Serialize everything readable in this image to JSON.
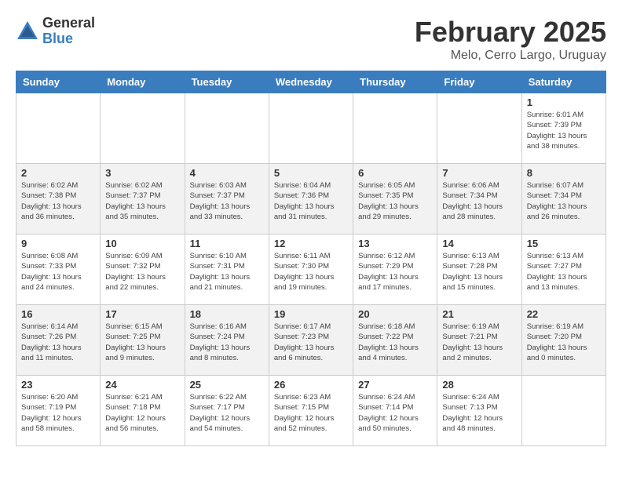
{
  "logo": {
    "general": "General",
    "blue": "Blue"
  },
  "title": "February 2025",
  "subtitle": "Melo, Cerro Largo, Uruguay",
  "days_of_week": [
    "Sunday",
    "Monday",
    "Tuesday",
    "Wednesday",
    "Thursday",
    "Friday",
    "Saturday"
  ],
  "weeks": [
    [
      {
        "day": "",
        "info": ""
      },
      {
        "day": "",
        "info": ""
      },
      {
        "day": "",
        "info": ""
      },
      {
        "day": "",
        "info": ""
      },
      {
        "day": "",
        "info": ""
      },
      {
        "day": "",
        "info": ""
      },
      {
        "day": "1",
        "info": "Sunrise: 6:01 AM\nSunset: 7:39 PM\nDaylight: 13 hours\nand 38 minutes."
      }
    ],
    [
      {
        "day": "2",
        "info": "Sunrise: 6:02 AM\nSunset: 7:38 PM\nDaylight: 13 hours\nand 36 minutes."
      },
      {
        "day": "3",
        "info": "Sunrise: 6:02 AM\nSunset: 7:37 PM\nDaylight: 13 hours\nand 35 minutes."
      },
      {
        "day": "4",
        "info": "Sunrise: 6:03 AM\nSunset: 7:37 PM\nDaylight: 13 hours\nand 33 minutes."
      },
      {
        "day": "5",
        "info": "Sunrise: 6:04 AM\nSunset: 7:36 PM\nDaylight: 13 hours\nand 31 minutes."
      },
      {
        "day": "6",
        "info": "Sunrise: 6:05 AM\nSunset: 7:35 PM\nDaylight: 13 hours\nand 29 minutes."
      },
      {
        "day": "7",
        "info": "Sunrise: 6:06 AM\nSunset: 7:34 PM\nDaylight: 13 hours\nand 28 minutes."
      },
      {
        "day": "8",
        "info": "Sunrise: 6:07 AM\nSunset: 7:34 PM\nDaylight: 13 hours\nand 26 minutes."
      }
    ],
    [
      {
        "day": "9",
        "info": "Sunrise: 6:08 AM\nSunset: 7:33 PM\nDaylight: 13 hours\nand 24 minutes."
      },
      {
        "day": "10",
        "info": "Sunrise: 6:09 AM\nSunset: 7:32 PM\nDaylight: 13 hours\nand 22 minutes."
      },
      {
        "day": "11",
        "info": "Sunrise: 6:10 AM\nSunset: 7:31 PM\nDaylight: 13 hours\nand 21 minutes."
      },
      {
        "day": "12",
        "info": "Sunrise: 6:11 AM\nSunset: 7:30 PM\nDaylight: 13 hours\nand 19 minutes."
      },
      {
        "day": "13",
        "info": "Sunrise: 6:12 AM\nSunset: 7:29 PM\nDaylight: 13 hours\nand 17 minutes."
      },
      {
        "day": "14",
        "info": "Sunrise: 6:13 AM\nSunset: 7:28 PM\nDaylight: 13 hours\nand 15 minutes."
      },
      {
        "day": "15",
        "info": "Sunrise: 6:13 AM\nSunset: 7:27 PM\nDaylight: 13 hours\nand 13 minutes."
      }
    ],
    [
      {
        "day": "16",
        "info": "Sunrise: 6:14 AM\nSunset: 7:26 PM\nDaylight: 13 hours\nand 11 minutes."
      },
      {
        "day": "17",
        "info": "Sunrise: 6:15 AM\nSunset: 7:25 PM\nDaylight: 13 hours\nand 9 minutes."
      },
      {
        "day": "18",
        "info": "Sunrise: 6:16 AM\nSunset: 7:24 PM\nDaylight: 13 hours\nand 8 minutes."
      },
      {
        "day": "19",
        "info": "Sunrise: 6:17 AM\nSunset: 7:23 PM\nDaylight: 13 hours\nand 6 minutes."
      },
      {
        "day": "20",
        "info": "Sunrise: 6:18 AM\nSunset: 7:22 PM\nDaylight: 13 hours\nand 4 minutes."
      },
      {
        "day": "21",
        "info": "Sunrise: 6:19 AM\nSunset: 7:21 PM\nDaylight: 13 hours\nand 2 minutes."
      },
      {
        "day": "22",
        "info": "Sunrise: 6:19 AM\nSunset: 7:20 PM\nDaylight: 13 hours\nand 0 minutes."
      }
    ],
    [
      {
        "day": "23",
        "info": "Sunrise: 6:20 AM\nSunset: 7:19 PM\nDaylight: 12 hours\nand 58 minutes."
      },
      {
        "day": "24",
        "info": "Sunrise: 6:21 AM\nSunset: 7:18 PM\nDaylight: 12 hours\nand 56 minutes."
      },
      {
        "day": "25",
        "info": "Sunrise: 6:22 AM\nSunset: 7:17 PM\nDaylight: 12 hours\nand 54 minutes."
      },
      {
        "day": "26",
        "info": "Sunrise: 6:23 AM\nSunset: 7:15 PM\nDaylight: 12 hours\nand 52 minutes."
      },
      {
        "day": "27",
        "info": "Sunrise: 6:24 AM\nSunset: 7:14 PM\nDaylight: 12 hours\nand 50 minutes."
      },
      {
        "day": "28",
        "info": "Sunrise: 6:24 AM\nSunset: 7:13 PM\nDaylight: 12 hours\nand 48 minutes."
      },
      {
        "day": "",
        "info": ""
      }
    ]
  ]
}
